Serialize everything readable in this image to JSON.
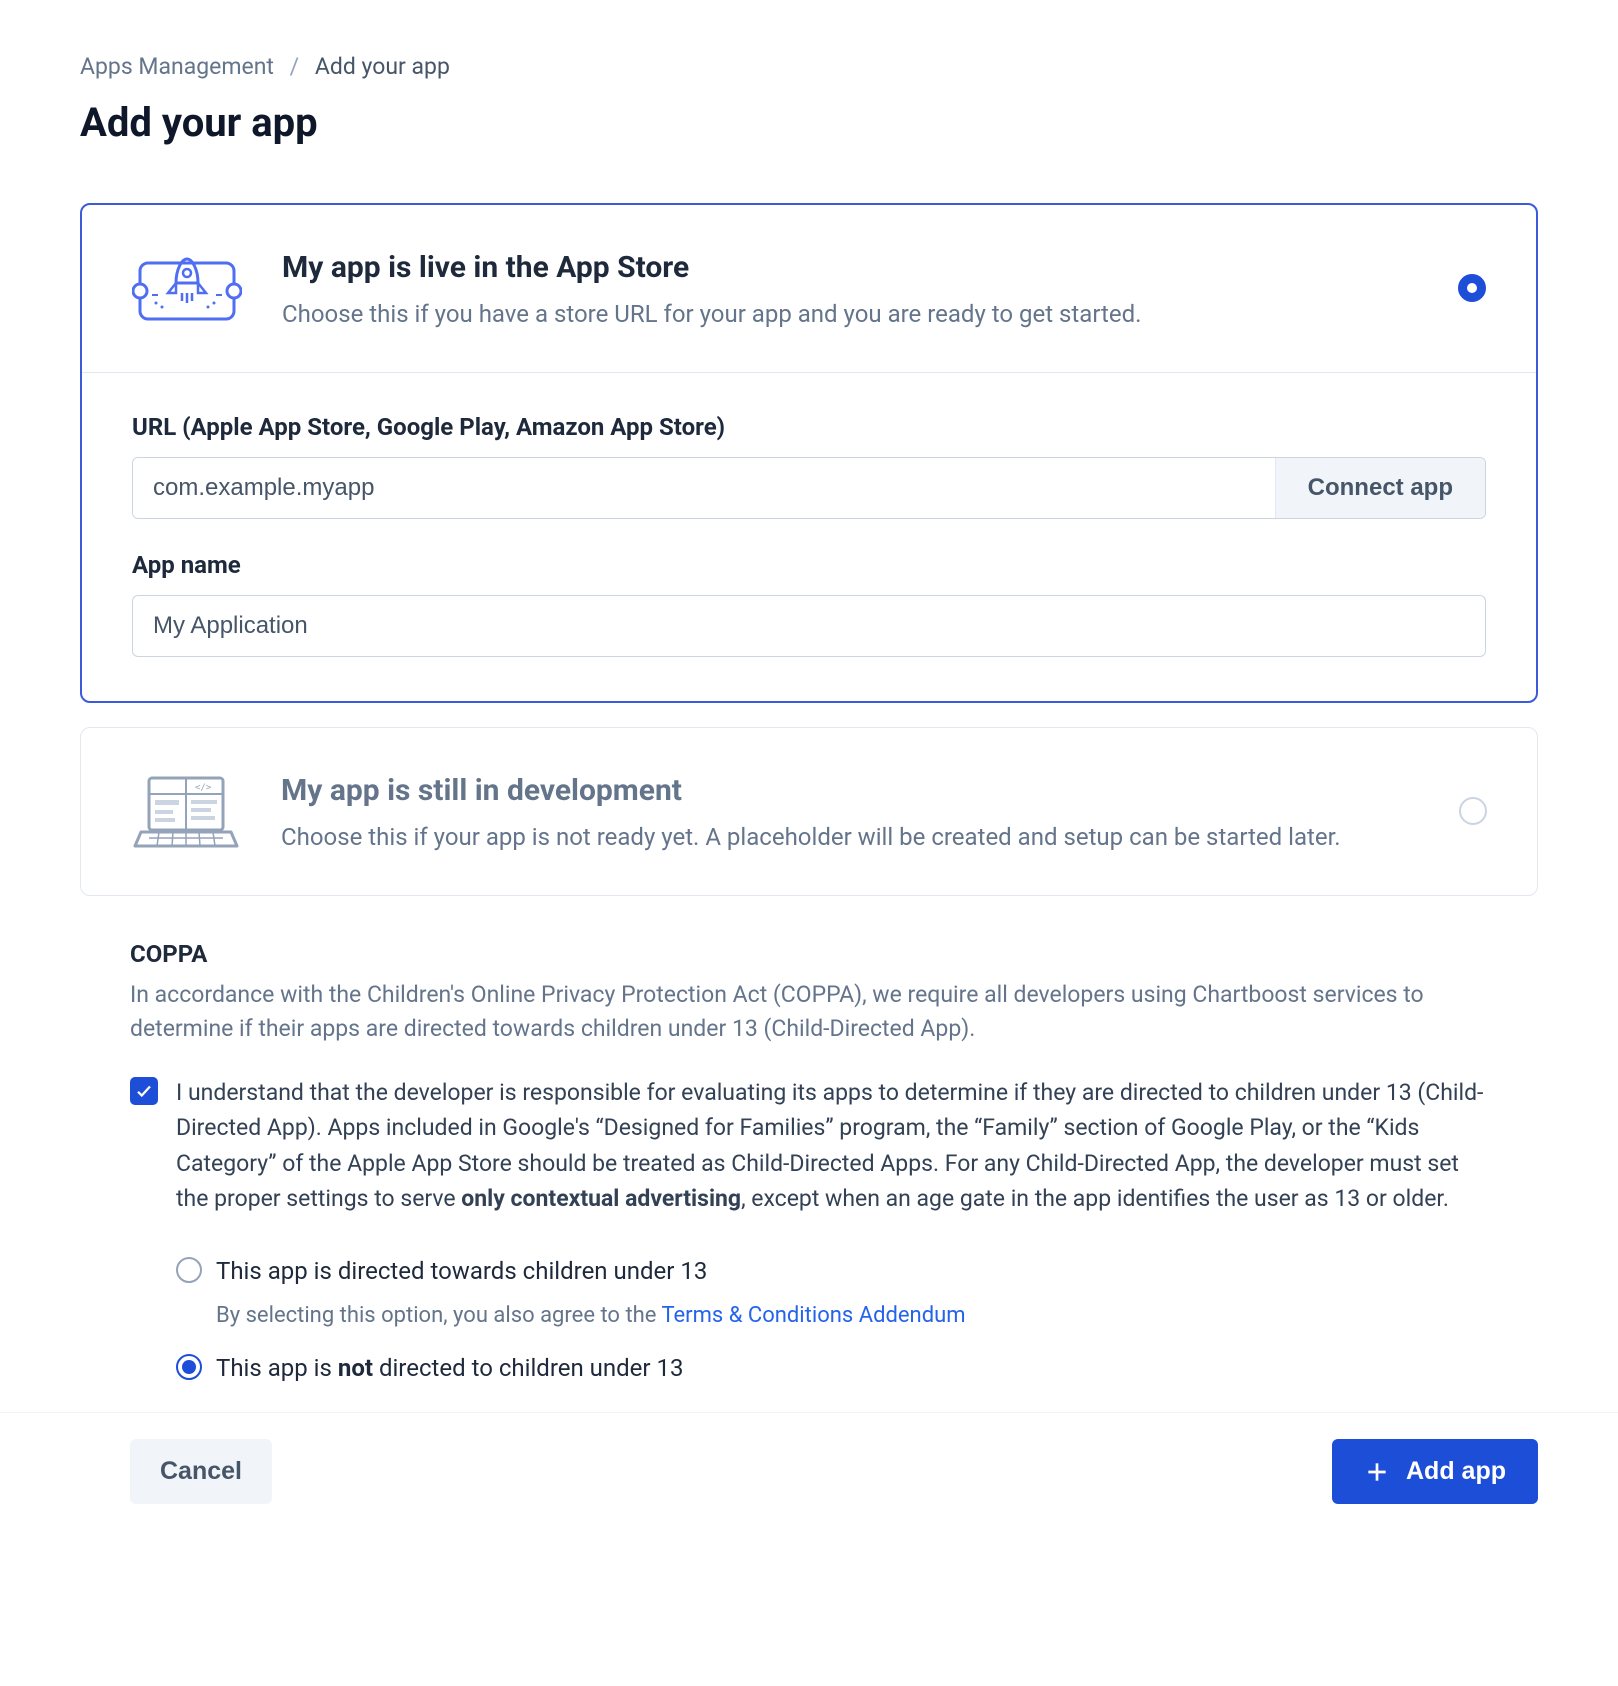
{
  "breadcrumb": {
    "parent": "Apps Management",
    "current": "Add your app"
  },
  "page_title": "Add your app",
  "option_live": {
    "title": "My app is live in the App Store",
    "description": "Choose this if you have a store URL for your app and you are ready to get started.",
    "selected": true,
    "url_label": "URL (Apple App Store, Google Play, Amazon App Store)",
    "url_value": "com.example.myapp",
    "connect_label": "Connect app",
    "app_name_label": "App name",
    "app_name_value": "My Application"
  },
  "option_dev": {
    "title": "My app is still in development",
    "description": "Choose this if your app is not ready yet. A placeholder will be created and setup can be started later.",
    "selected": false
  },
  "coppa": {
    "heading": "COPPA",
    "intro": "In accordance with the Children's Online Privacy Protection Act (COPPA), we require all developers using Chartboost services to determine if their apps are directed towards children under 13 (Child-Directed App).",
    "ack_checked": true,
    "ack_text_pre": "I understand that the developer is responsible for evaluating its apps to determine if they are directed to children under 13 (Child-Directed App). Apps included in Google's “Designed for Families” program, the “Family” section of Google Play, or the “Kids Category” of the Apple App Store should be treated as Child-Directed Apps. For any Child-Directed App, the developer must set the proper settings to serve ",
    "ack_text_bold": "only contextual advertising",
    "ack_text_post": ", except when an age gate in the app identifies the user as 13 or older.",
    "opt_directed_label": "This app is directed towards children under 13",
    "opt_directed_sub_pre": "By selecting this option, you also agree to the ",
    "opt_directed_sub_link": "Terms & Conditions Addendum",
    "opt_not_pre": "This app is ",
    "opt_not_bold": "not",
    "opt_not_post": " directed to children under 13",
    "selected": "not_directed"
  },
  "footer": {
    "cancel": "Cancel",
    "add": "Add app"
  }
}
